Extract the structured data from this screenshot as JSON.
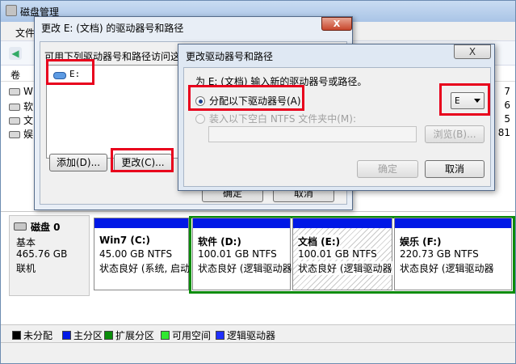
{
  "main_window": {
    "title": "磁盘管理",
    "menu_file": "文件",
    "volume_header": "卷",
    "volume_items": [
      "W",
      "软",
      "文",
      "娱"
    ],
    "right_col_values": [
      "7",
      "6",
      "5",
      "81"
    ]
  },
  "disk": {
    "name": "磁盘 0",
    "type": "基本",
    "size": "465.76 GB",
    "status": "联机",
    "partitions": [
      {
        "name": "Win7 (C:)",
        "size": "45.00 GB NTFS",
        "status": "状态良好 (系统, 启动"
      },
      {
        "name": "软件 (D:)",
        "size": "100.01 GB NTFS",
        "status": "状态良好 (逻辑驱动器"
      },
      {
        "name": "文档 (E:)",
        "size": "100.01 GB NTFS",
        "status": "状态良好 (逻辑驱动器"
      },
      {
        "name": "娱乐 (F:)",
        "size": "220.73 GB NTFS",
        "status": "状态良好 (逻辑驱动器"
      }
    ]
  },
  "legend": [
    {
      "label": "未分配",
      "color": "#000000"
    },
    {
      "label": "主分区",
      "color": "#0018e6"
    },
    {
      "label": "扩展分区",
      "color": "#0a8c0a"
    },
    {
      "label": "可用空间",
      "color": "#30e830"
    },
    {
      "label": "逻辑驱动器",
      "color": "#1f2fff"
    }
  ],
  "dialog1": {
    "title": "更改 E: (文档) 的驱动器号和路径",
    "prompt": "可用下列驱动器号和路径访问这",
    "list_item": "E:",
    "add_button": "添加(D)...",
    "change_button": "更改(C)...",
    "ok_button": "确定",
    "cancel_button": "取消",
    "close_label": "X"
  },
  "dialog2": {
    "title": "更改驱动器号和路径",
    "prompt": "为 E: (文档) 输入新的驱动器号或路径。",
    "radio_assign": "分配以下驱动器号(A):",
    "radio_mount": "装入以下空白 NTFS 文件夹中(M):",
    "drive_letter": "E",
    "browse_button": "浏览(B)...",
    "ok_button": "确定",
    "cancel_button": "取消",
    "close_label": "X"
  }
}
